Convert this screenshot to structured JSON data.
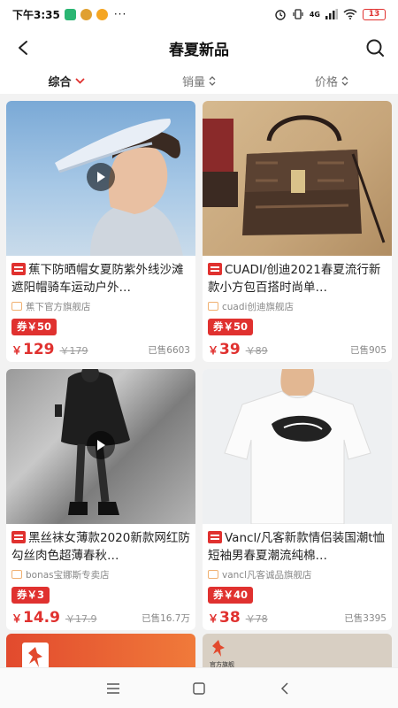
{
  "status_bar": {
    "time": "下午3:35",
    "dots": "···",
    "network": "4G",
    "battery": "13"
  },
  "header": {
    "title": "春夏新品"
  },
  "sort_bar": {
    "items": [
      {
        "label": "综合"
      },
      {
        "label": "销量"
      },
      {
        "label": "价格"
      }
    ]
  },
  "colors": {
    "accent": "#e0312f",
    "background": "#f2f2f2"
  },
  "products": [
    {
      "title": "蕉下防晒帽女夏防紫外线沙滩遮阳帽骑车运动户外…",
      "shop": "蕉下官方旗舰店",
      "coupon": "券￥50",
      "price": "129",
      "original_price": "￥179",
      "sold": "已售6603"
    },
    {
      "title": "CUADI/创迪2021春夏流行新款小方包百搭时尚单…",
      "shop": "cuadi创迪旗舰店",
      "coupon": "券￥50",
      "price": "39",
      "original_price": "￥89",
      "sold": "已售905"
    },
    {
      "title": "黑丝袜女薄款2020新款网红防勾丝肉色超薄春秋…",
      "shop": "bonas宝娜斯专卖店",
      "coupon": "券￥3",
      "price": "14.9",
      "original_price": "￥17.9",
      "sold": "已售16.7万"
    },
    {
      "title": "Vancl/凡客新款情侣装国潮t恤短袖男春夏潮流纯棉…",
      "shop": "vancl凡客诚品旗舰店",
      "coupon": "券￥40",
      "price": "38",
      "original_price": "￥78",
      "sold": "已售3395"
    }
  ],
  "partial_right_label": "官方旗舰",
  "currency": "￥"
}
